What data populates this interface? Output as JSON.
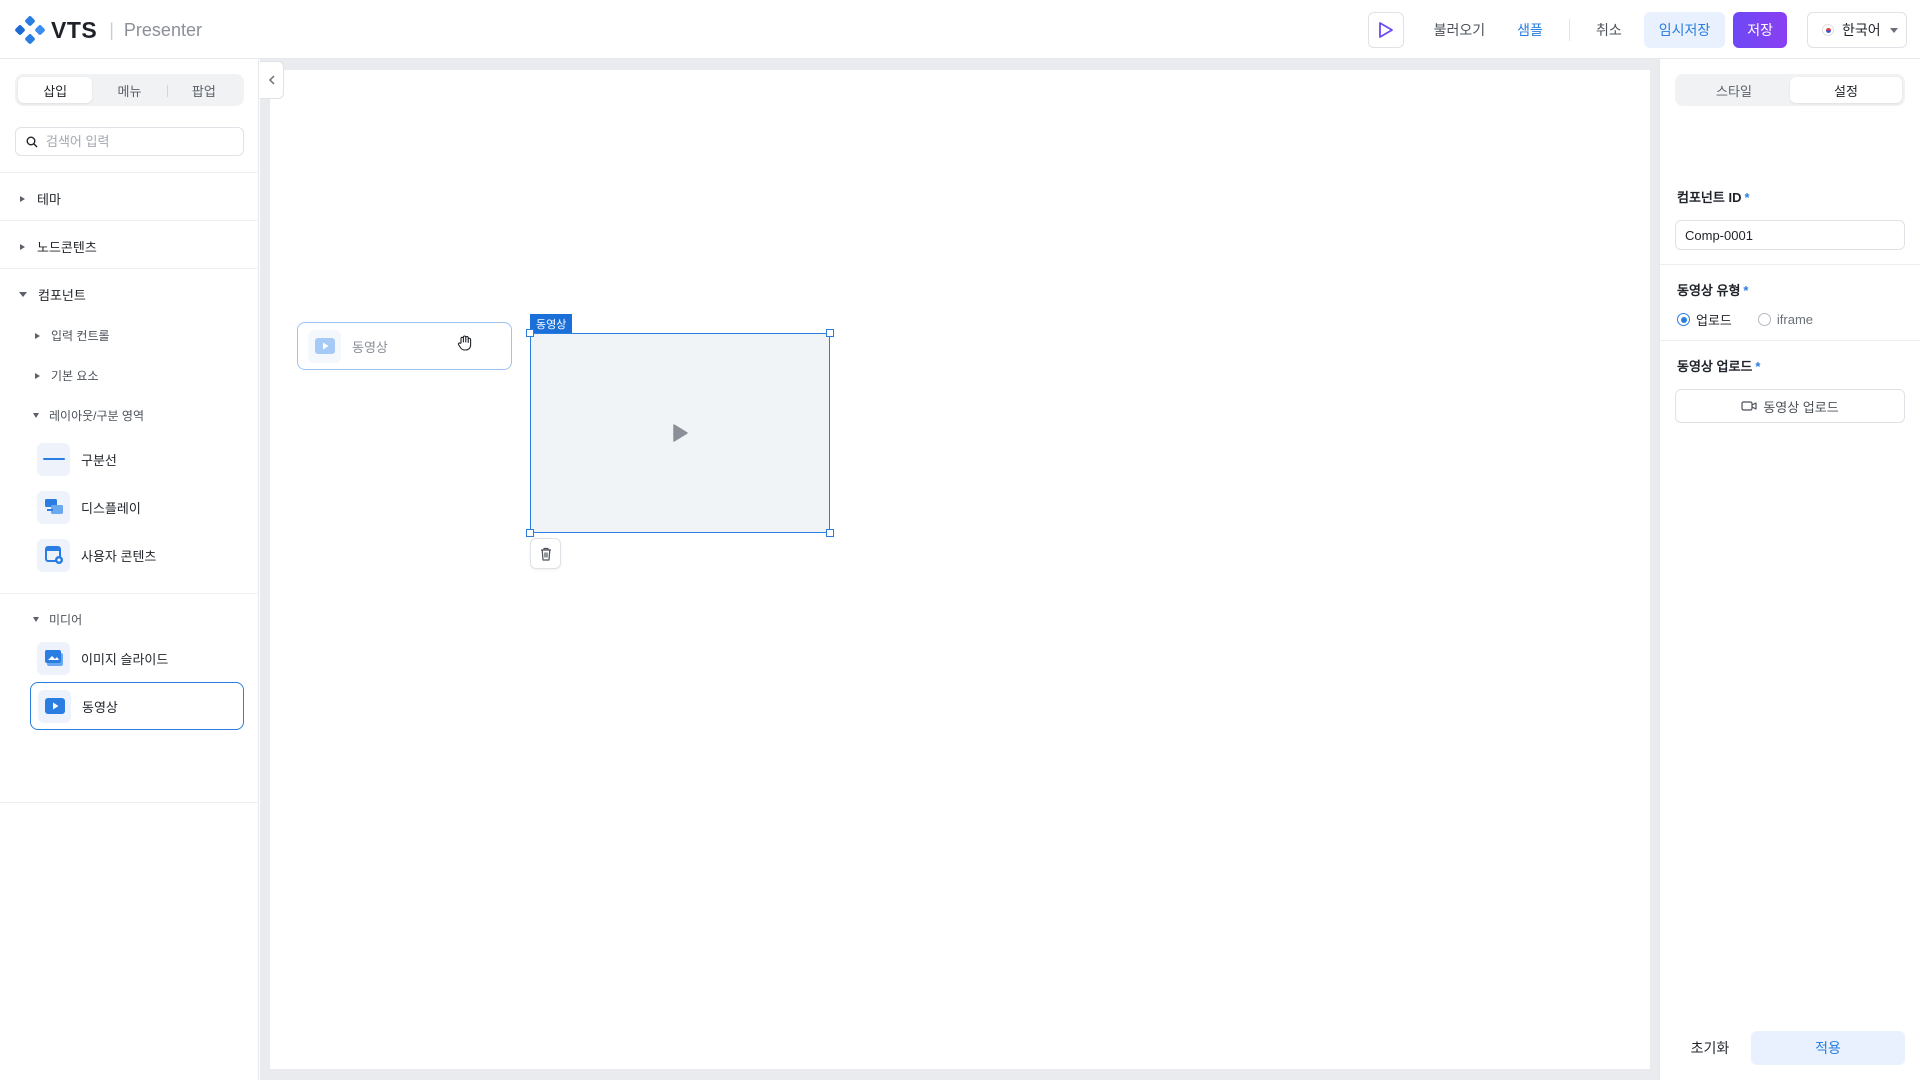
{
  "header": {
    "logo_text": "VTS",
    "logo_sub": "Presenter",
    "load_label": "불러오기",
    "sample_label": "샘플",
    "cancel_label": "취소",
    "temp_save_label": "임시저장",
    "save_label": "저장",
    "language": "한국어"
  },
  "left": {
    "tabs": [
      "삽입",
      "메뉴",
      "팝업"
    ],
    "search_placeholder": "검색어 입력",
    "sections": {
      "theme": "테마",
      "node_contents": "노드콘텐츠",
      "components": "컴포넌트"
    },
    "sub": {
      "input_controls": "입력 컨트롤",
      "basic_elements": "기본 요소",
      "layout": "레이아웃/구분 영역",
      "media": "미디어"
    },
    "layout_items": [
      "구분선",
      "디스플레이",
      "사용자 콘텐츠"
    ],
    "media_items": [
      "이미지 슬라이드",
      "동영상"
    ]
  },
  "canvas": {
    "drag_label": "동영상",
    "video_tag": "동영상"
  },
  "right": {
    "tabs": [
      "스타일",
      "설정"
    ],
    "component_id_label": "컴포넌트 ID",
    "component_id_value": "Comp-0001",
    "video_type_label": "동영상 유형",
    "radio_upload": "업로드",
    "radio_iframe": "iframe",
    "video_upload_label": "동영상 업로드",
    "upload_button": "동영상 업로드",
    "reset_label": "초기화",
    "apply_label": "적용"
  }
}
